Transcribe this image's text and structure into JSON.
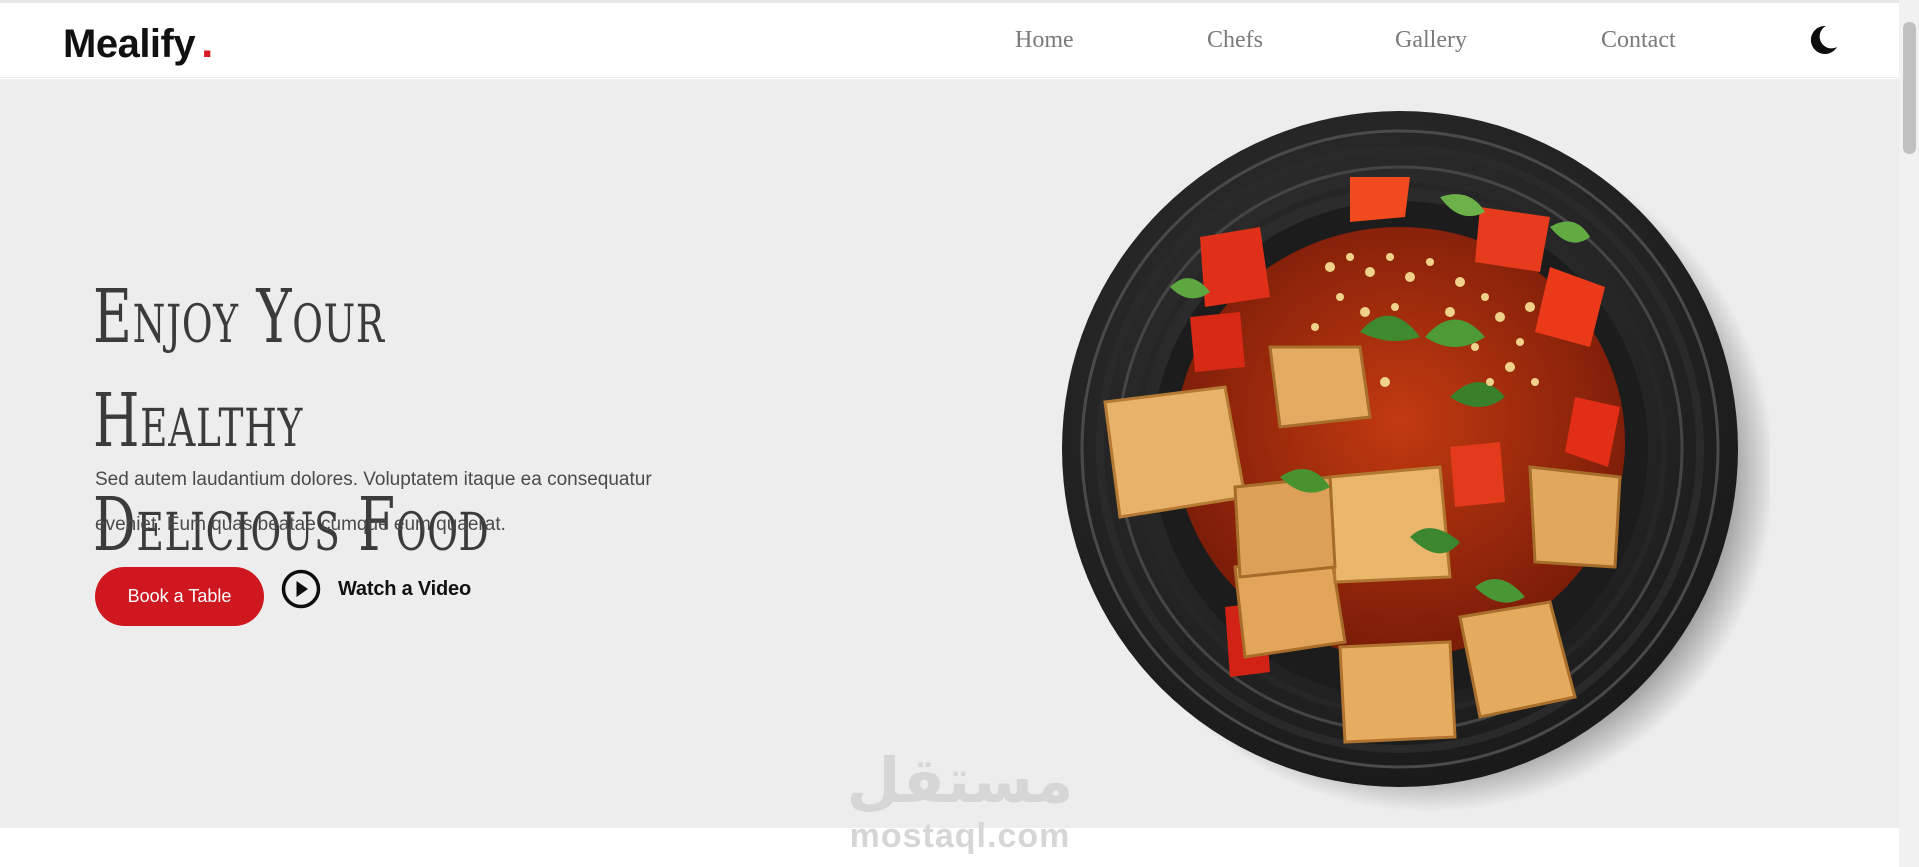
{
  "header": {
    "brand": "Mealify",
    "brand_dot": ".",
    "nav": {
      "home": "Home",
      "chefs": "Chefs",
      "gallery": "Gallery",
      "contact": "Contact"
    },
    "theme_icon": "moon-icon"
  },
  "hero": {
    "title_line1": "Enjoy Your Healthy",
    "title_line2": "Delicious Food",
    "description": "Sed autem laudantium dolores. Voluptatem itaque ea consequatur eveniet. Eum quas beatae cumque eum quaerat.",
    "book_button": "Book a Table",
    "video_button": "Watch a Video",
    "video_icon": "play-circle-icon",
    "image_icon": "food-plate-image"
  },
  "watermark": {
    "arabic": "مستقل",
    "latin": "mostaql.com"
  },
  "colors": {
    "accent": "#cf171f",
    "hero_bg": "#ededed",
    "nav_text": "#7a7a7a",
    "title_text": "#3b3b3b"
  }
}
